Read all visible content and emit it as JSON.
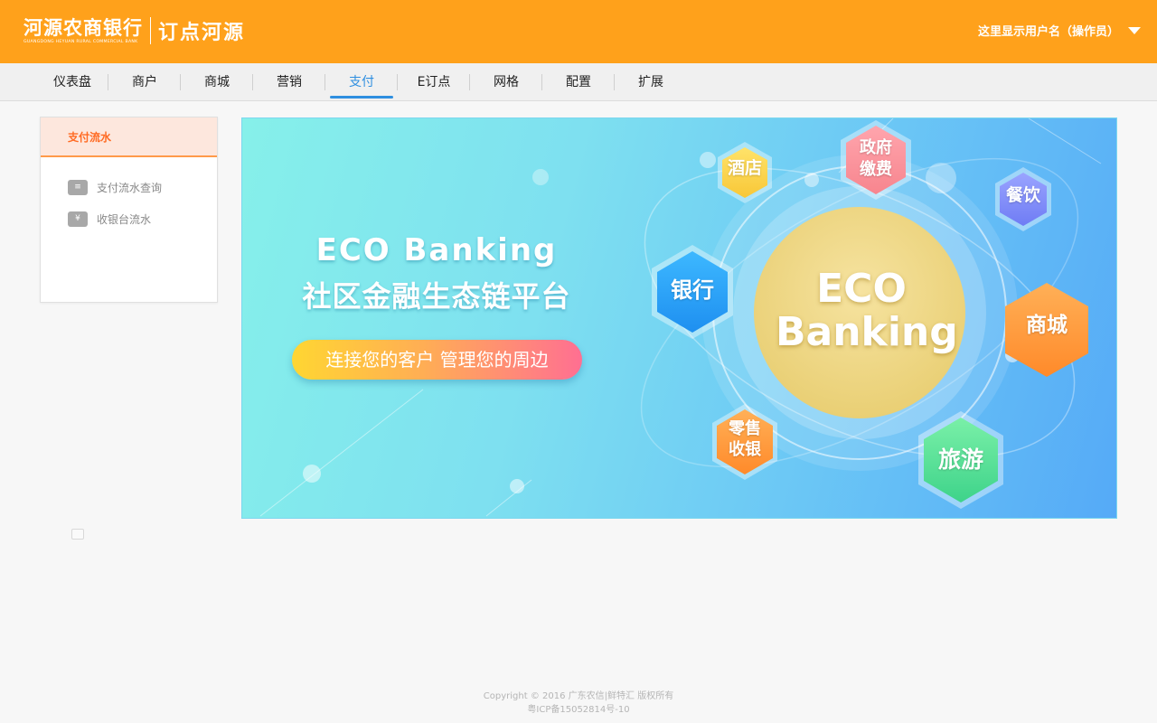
{
  "header": {
    "logo_cn": "河源农商银行",
    "logo_en": "GUANGDONG HEYUAN RURAL COMMERCIAL BANK",
    "logo_right": "订点河源",
    "user_label": "这里显示用户名（操作员）"
  },
  "nav": {
    "items": [
      "仪表盘",
      "商户",
      "商城",
      "营销",
      "支付",
      "E订点",
      "网格",
      "配置",
      "扩展"
    ],
    "active_index": 4
  },
  "sidebar": {
    "title": "支付流水",
    "items": [
      {
        "label": "支付流水查询",
        "icon": "document-icon"
      },
      {
        "label": "收银台流水",
        "icon": "cashier-icon"
      }
    ]
  },
  "banner": {
    "title_en": "ECO Banking",
    "title_cn": "社区金融生态链平台",
    "slogan": "连接您的客户 管理您的周边",
    "center_line1": "ECO",
    "center_line2": "Banking",
    "hexagons": {
      "hotel": "酒店",
      "gov1": "政府",
      "gov2": "缴费",
      "dining": "餐饮",
      "bank": "银行",
      "mall": "商城",
      "retail1": "零售",
      "retail2": "收银",
      "travel": "旅游"
    }
  },
  "footer": {
    "copyright": "Copyright © 2016 广东农信|鲜特汇 版权所有",
    "icp": "粤ICP备15052814号-10"
  },
  "colors": {
    "header_bg": "#ffa11b",
    "nav_active": "#2f8fe0",
    "sidebar_accent": "#ff6a22"
  }
}
